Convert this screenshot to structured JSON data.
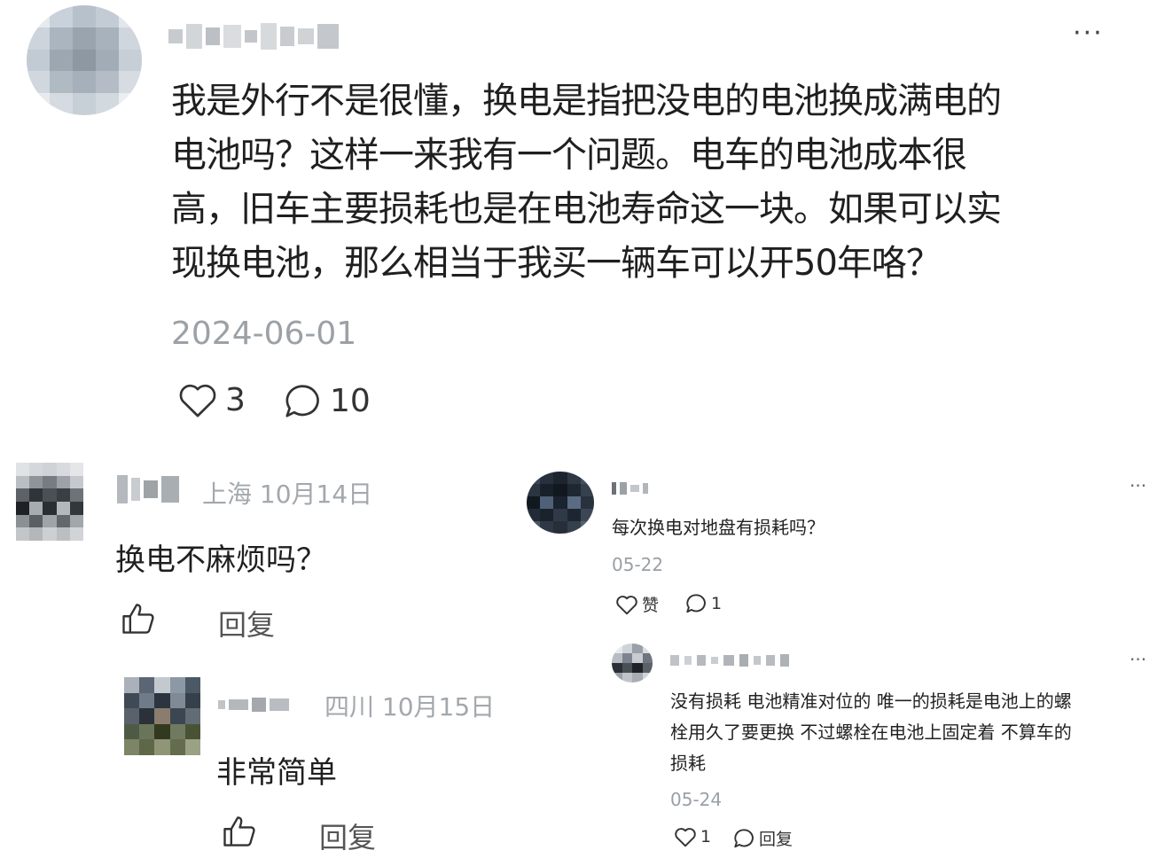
{
  "main_post": {
    "text_lines": [
      "我是外行不是很懂，换电是指把没电的电池换成满电的",
      "电池吗？这样一来我有一个问题。电车的电池成本很",
      "高，旧车主要损耗也是在电池寿命这一块。如果可以实",
      "现换电池，那么相当于我买一辆车可以开50年咯？"
    ],
    "date": "2024-06-01",
    "likes": "3",
    "comments": "10",
    "more_label": "···"
  },
  "left_thread": {
    "comment": {
      "location_date": "上海 10月14日",
      "text": "换电不麻烦吗？",
      "reply_label": "回复"
    },
    "reply": {
      "location_date": "四川 10月15日",
      "text": "非常简单",
      "reply_label": "回复"
    }
  },
  "right_thread": {
    "comment": {
      "text": "每次换电对地盘有损耗吗？",
      "date": "05-22",
      "like_label": "赞",
      "comment_count": "1",
      "more_label": "···"
    },
    "reply": {
      "text_lines": [
        "没有损耗 电池精准对位的 唯一的损耗是电池上的螺",
        "栓用久了要更换 不过螺栓在电池上固定着 不算车的",
        "损耗"
      ],
      "date": "05-24",
      "like_count": "1",
      "reply_label": "回复",
      "more_label": "···"
    }
  }
}
